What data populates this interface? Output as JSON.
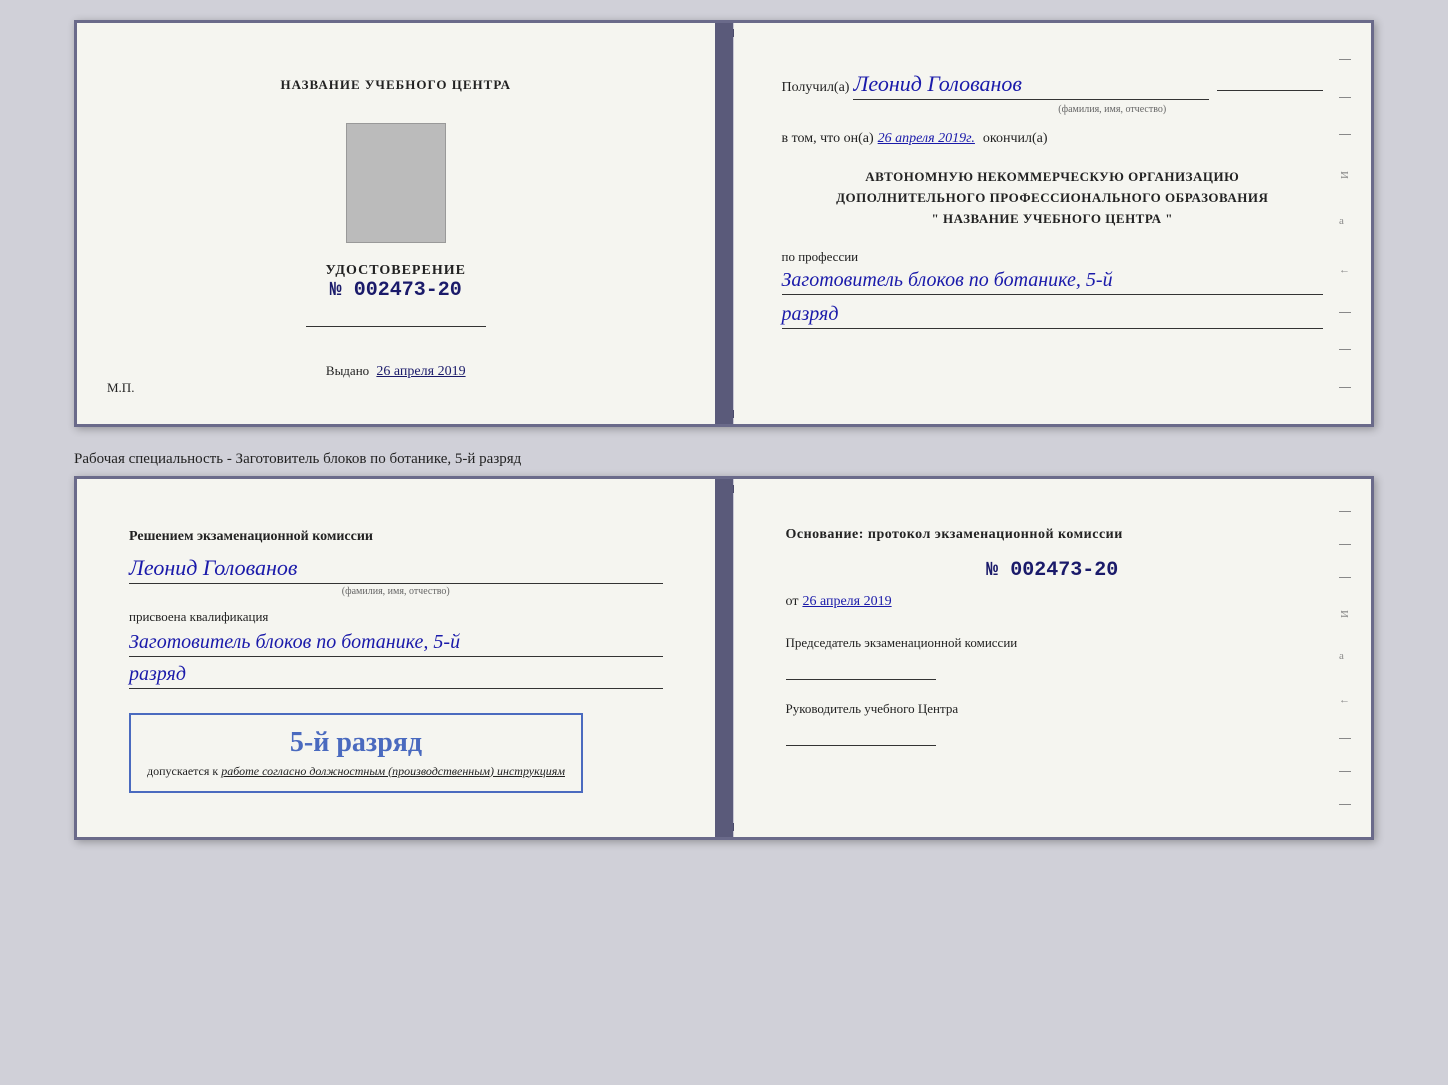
{
  "cert_top": {
    "left": {
      "center_title": "НАЗВАНИЕ УЧЕБНОГО ЦЕНТРА",
      "udostoverenie_label": "УДОСТОВЕРЕНИЕ",
      "number": "№ 002473-20",
      "vydano_label": "Выдано",
      "vydano_date": "26 апреля 2019",
      "mp_label": "М.П."
    },
    "right": {
      "poluchil_label": "Получил(а)",
      "recipient_name": "Леонид Голованов",
      "fio_subtitle": "(фамилия, имя, отчество)",
      "vtom_prefix": "в том, что он(а)",
      "vtom_date": "26 апреля 2019г.",
      "okonchil_label": "окончил(а)",
      "org_line1": "АВТОНОМНУЮ НЕКОММЕРЧЕСКУЮ ОРГАНИЗАЦИЮ",
      "org_line2": "ДОПОЛНИТЕЛЬНОГО ПРОФЕССИОНАЛЬНОГО ОБРАЗОВАНИЯ",
      "org_line3": "\"  НАЗВАНИЕ УЧЕБНОГО ЦЕНТРА  \"",
      "po_professii_label": "по профессии",
      "profession": "Заготовитель блоков по ботанике, 5-й",
      "razryad": "разряд"
    }
  },
  "specialty_label": "Рабочая специальность - Заготовитель блоков по ботанике, 5-й разряд",
  "cert_bottom": {
    "left": {
      "resheniem_text": "Решением экзаменационной комиссии",
      "recipient_name": "Леонид Голованов",
      "fio_subtitle": "(фамилия, имя, отчество)",
      "prisvoyena_text": "присвоена квалификация",
      "profession": "Заготовитель блоков по ботанике, 5-й",
      "razryad": "разряд",
      "stamp_razryad": "5-й разряд",
      "dopuskaetsya_prefix": "допускается к",
      "dopuskaetsya_rest": "работе согласно должностным (производственным) инструкциям"
    },
    "right": {
      "osnovanie_text": "Основание: протокол экзаменационной комиссии",
      "protocol_number": "№  002473-20",
      "ot_label": "от",
      "ot_date": "26 апреля 2019",
      "predsedatel_label": "Председатель экзаменационной комиссии",
      "rukovoditel_label": "Руководитель учебного Центра"
    }
  }
}
